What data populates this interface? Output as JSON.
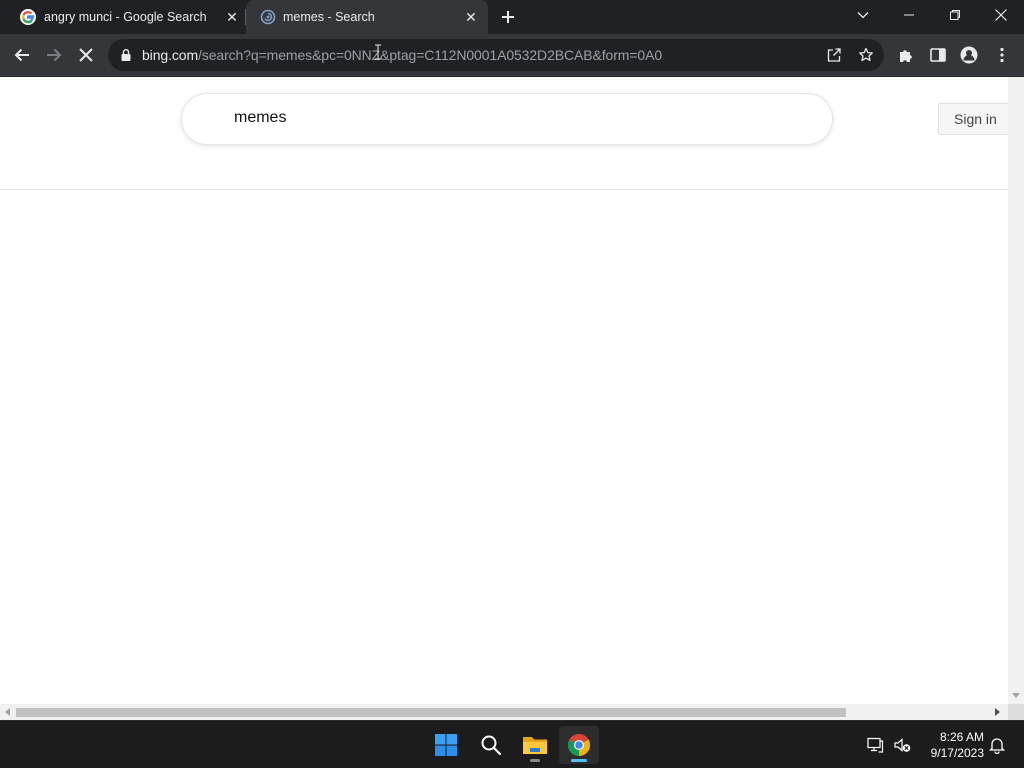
{
  "browser": {
    "tabs": [
      {
        "title": "angry munci - Google Search",
        "favicon": "google-icon",
        "active": false
      },
      {
        "title": "memes - Search",
        "favicon": "bing-icon",
        "active": true
      }
    ],
    "url_host": "bing.com",
    "url_path": "/search?q=memes&pc=0NNZ&ptag=C112N0001A0532D2BCAB&form=0A0"
  },
  "page": {
    "search_query": "memes",
    "signin_label": "Sign in"
  },
  "taskbar": {
    "apps": [
      "windows-start-icon",
      "search-icon",
      "file-explorer-icon",
      "chrome-icon"
    ],
    "time": "8:26 AM",
    "date": "9/17/2023"
  },
  "colors": {
    "chrome_dark": "#202124",
    "toolbar": "#35363a",
    "taskbar": "#1c1c1c",
    "accent": "#4cc2ff"
  }
}
